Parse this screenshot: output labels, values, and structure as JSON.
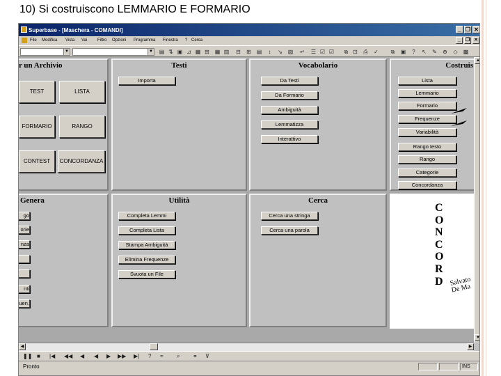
{
  "slide": {
    "title": "10) Si costruiscono LEMMARIO E FORMARIO"
  },
  "window": {
    "title": "Superbase - [Maschera - COMANDI]",
    "controls": [
      "_",
      "❐",
      "✕"
    ]
  },
  "menu": [
    "File",
    "Modifica",
    "Vista",
    "Vai",
    "Filtro",
    "Opzioni",
    "Programma",
    "Finestra",
    "?",
    "Cerca"
  ],
  "panels": {
    "archivio": {
      "title": "r un Archivio",
      "buttons": [
        "TEST",
        "LISTA",
        "FORMARIO",
        "RANGO",
        "CONTEST",
        "CONCORDANZA"
      ]
    },
    "testi": {
      "title": "Testi",
      "buttons": [
        "Importa"
      ]
    },
    "vocabolario": {
      "title": "Vocabolario",
      "buttons": [
        "Da Testi",
        "Da Formario",
        "Ambiguità",
        "Lemmatizza",
        "Interattivo"
      ]
    },
    "costruisci": {
      "title": "Costruis",
      "buttons": [
        "Lista",
        "Lemmario",
        "Formario",
        "Frequenze",
        "Variabilità",
        "Rango testo",
        "Rango",
        "Categorie",
        "Concordanza"
      ]
    },
    "genera": {
      "title": "Genera",
      "buttons": [
        "go",
        "orie",
        "nza",
        "",
        "",
        "nti",
        "uen."
      ]
    },
    "utilita": {
      "title": "Utilità",
      "buttons": [
        "Completa Lemmi",
        "Completa Lista",
        "Stampa Ambiguità",
        "Elimina Frequenze",
        "Svuota un File"
      ]
    },
    "cerca": {
      "title": "Cerca",
      "buttons": [
        "Cerca una stringa",
        "Cerca una parola"
      ]
    }
  },
  "logo": {
    "letters": [
      "C",
      "O",
      "N",
      "C",
      "O",
      "R",
      "D"
    ],
    "author_line1": "Salvato",
    "author_line2": "De Ma"
  },
  "status": {
    "text": "Pronto",
    "cell_right": "INS"
  }
}
